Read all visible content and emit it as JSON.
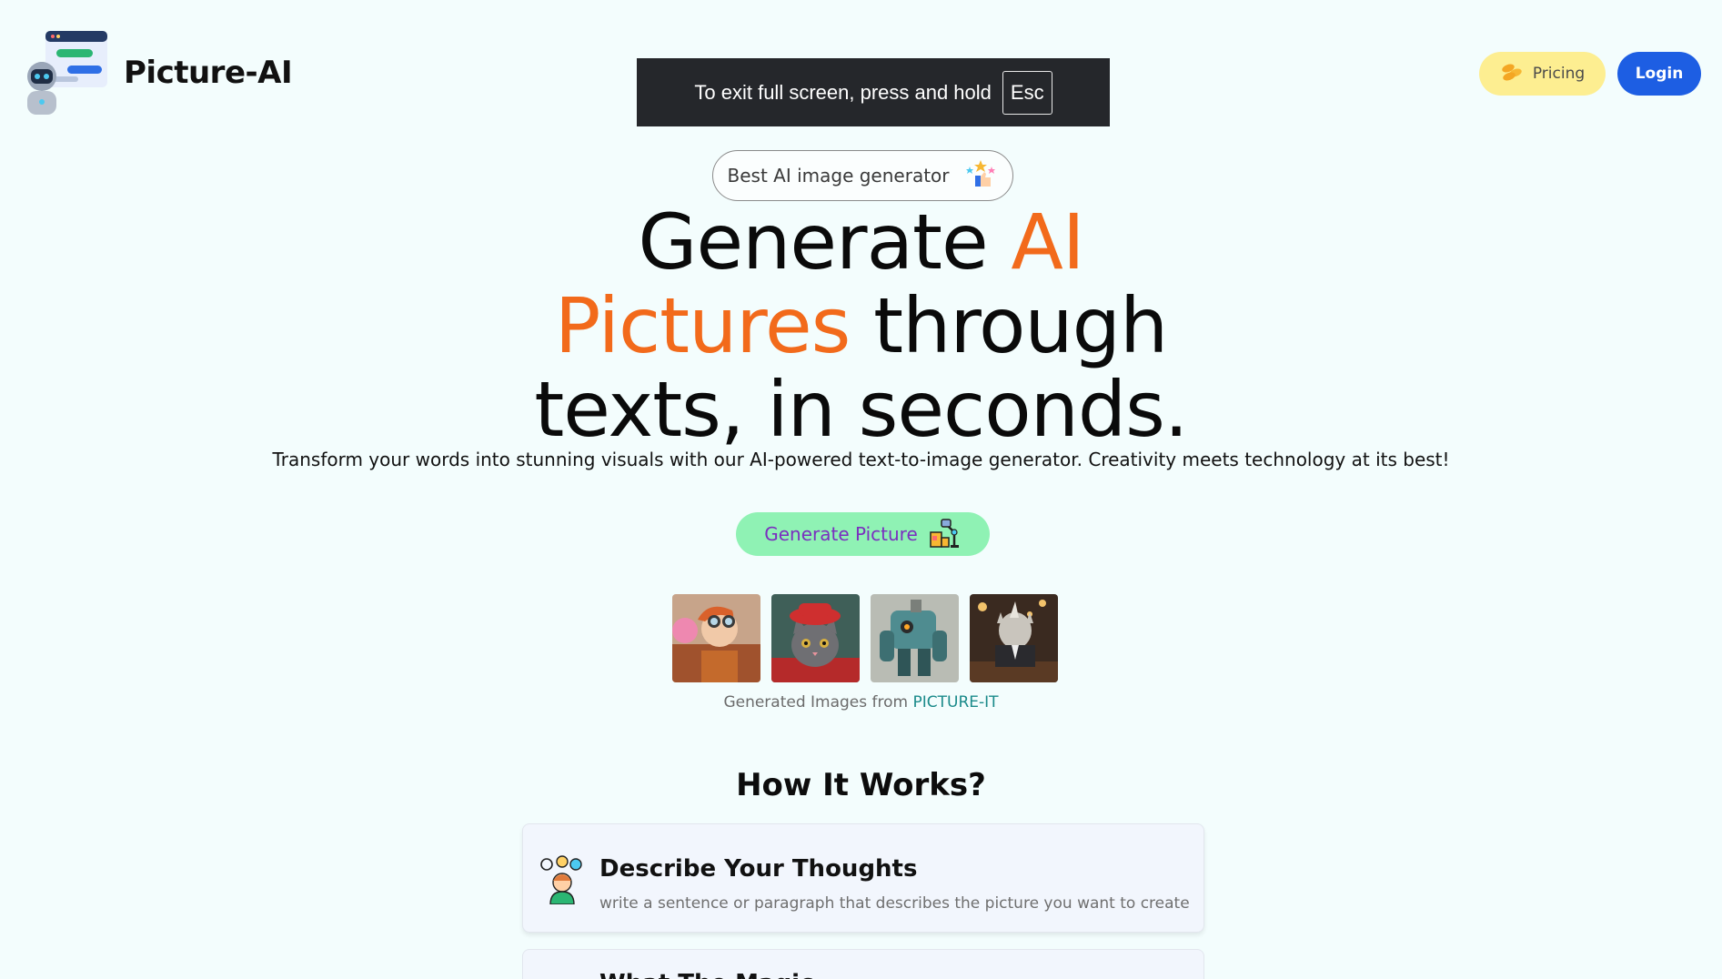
{
  "header": {
    "brand_name": "Picture-AI",
    "brand_logo_icon": "robot-chat-logo-icon",
    "pricing_label": "Pricing",
    "pricing_icon": "coins-icon",
    "login_label": "Login"
  },
  "fullscreen_toast": {
    "text": "To exit full screen, press and hold",
    "key": "Esc"
  },
  "hero": {
    "badge_label": "Best AI image generator",
    "badge_icon": "stars-thumbs-up-icon",
    "headline_part1": "Generate ",
    "headline_accent1": "AI",
    "headline_accent2": "Pictures",
    "headline_part2": " through",
    "headline_line3": "texts, in seconds.",
    "subtitle": "Transform your words into stunning visuals with our AI-powered text-to-image generator. Creativity meets technology at its best!",
    "cta_label": "Generate Picture",
    "cta_icon": "robot-arm-icon"
  },
  "gallery": {
    "images": [
      {
        "alt": "woman with goggles"
      },
      {
        "alt": "cat with red hat"
      },
      {
        "alt": "robot mech"
      },
      {
        "alt": "rhino in suit"
      }
    ],
    "caption_prefix": "Generated Images from ",
    "caption_link": "PICTURE-IT"
  },
  "how_it_works": {
    "title": "How It Works?",
    "steps": [
      {
        "title": "Describe Your Thoughts",
        "description": "write a sentence or paragraph that describes the picture you want to create",
        "icon": "person-thinking-icon"
      },
      {
        "title": "What The Magic",
        "description": ""
      }
    ]
  },
  "colors": {
    "background": "#f3fdfd",
    "accent_orange": "#f26a1b",
    "login_blue": "#1d5ee3",
    "pricing_yellow": "#fdee91",
    "cta_green": "#8ff2b4",
    "cta_text_purple": "#7a2fbf"
  }
}
